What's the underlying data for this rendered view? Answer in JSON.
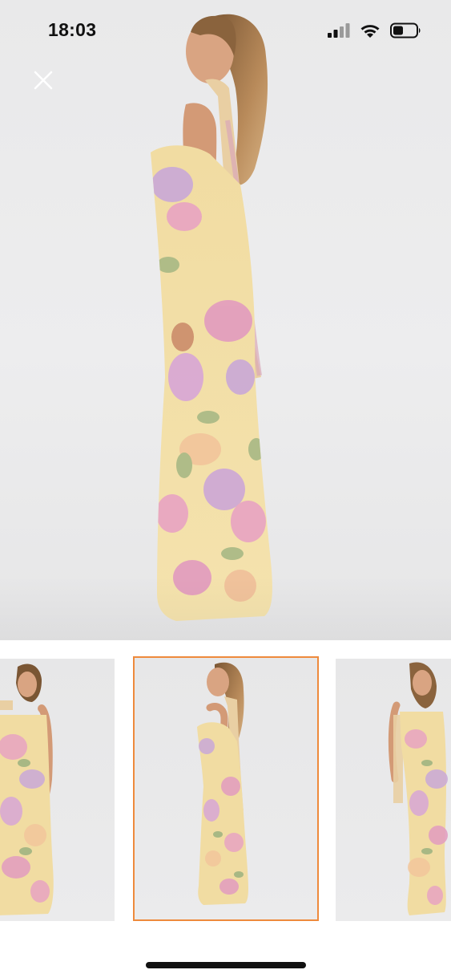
{
  "status_bar": {
    "time": "18:03",
    "icons": [
      "cellular-signal-icon",
      "wifi-icon",
      "battery-icon"
    ]
  },
  "viewer": {
    "close_icon": "close-icon",
    "main_image": "product-photo-side-view",
    "selected_thumbnail_index": 1
  },
  "thumbnails": [
    {
      "name": "thumbnail-front-view",
      "selected": false
    },
    {
      "name": "thumbnail-side-view",
      "selected": true
    },
    {
      "name": "thumbnail-three-quarter-view",
      "selected": false
    }
  ],
  "colors": {
    "selected_border": "#ee8a3c",
    "dress_base": "#f3dfa2",
    "dress_flower_pink": "#e8a3c2",
    "dress_flower_lilac": "#c9a8d8",
    "dress_leaf": "#a8b884",
    "background": "#ebebec"
  }
}
